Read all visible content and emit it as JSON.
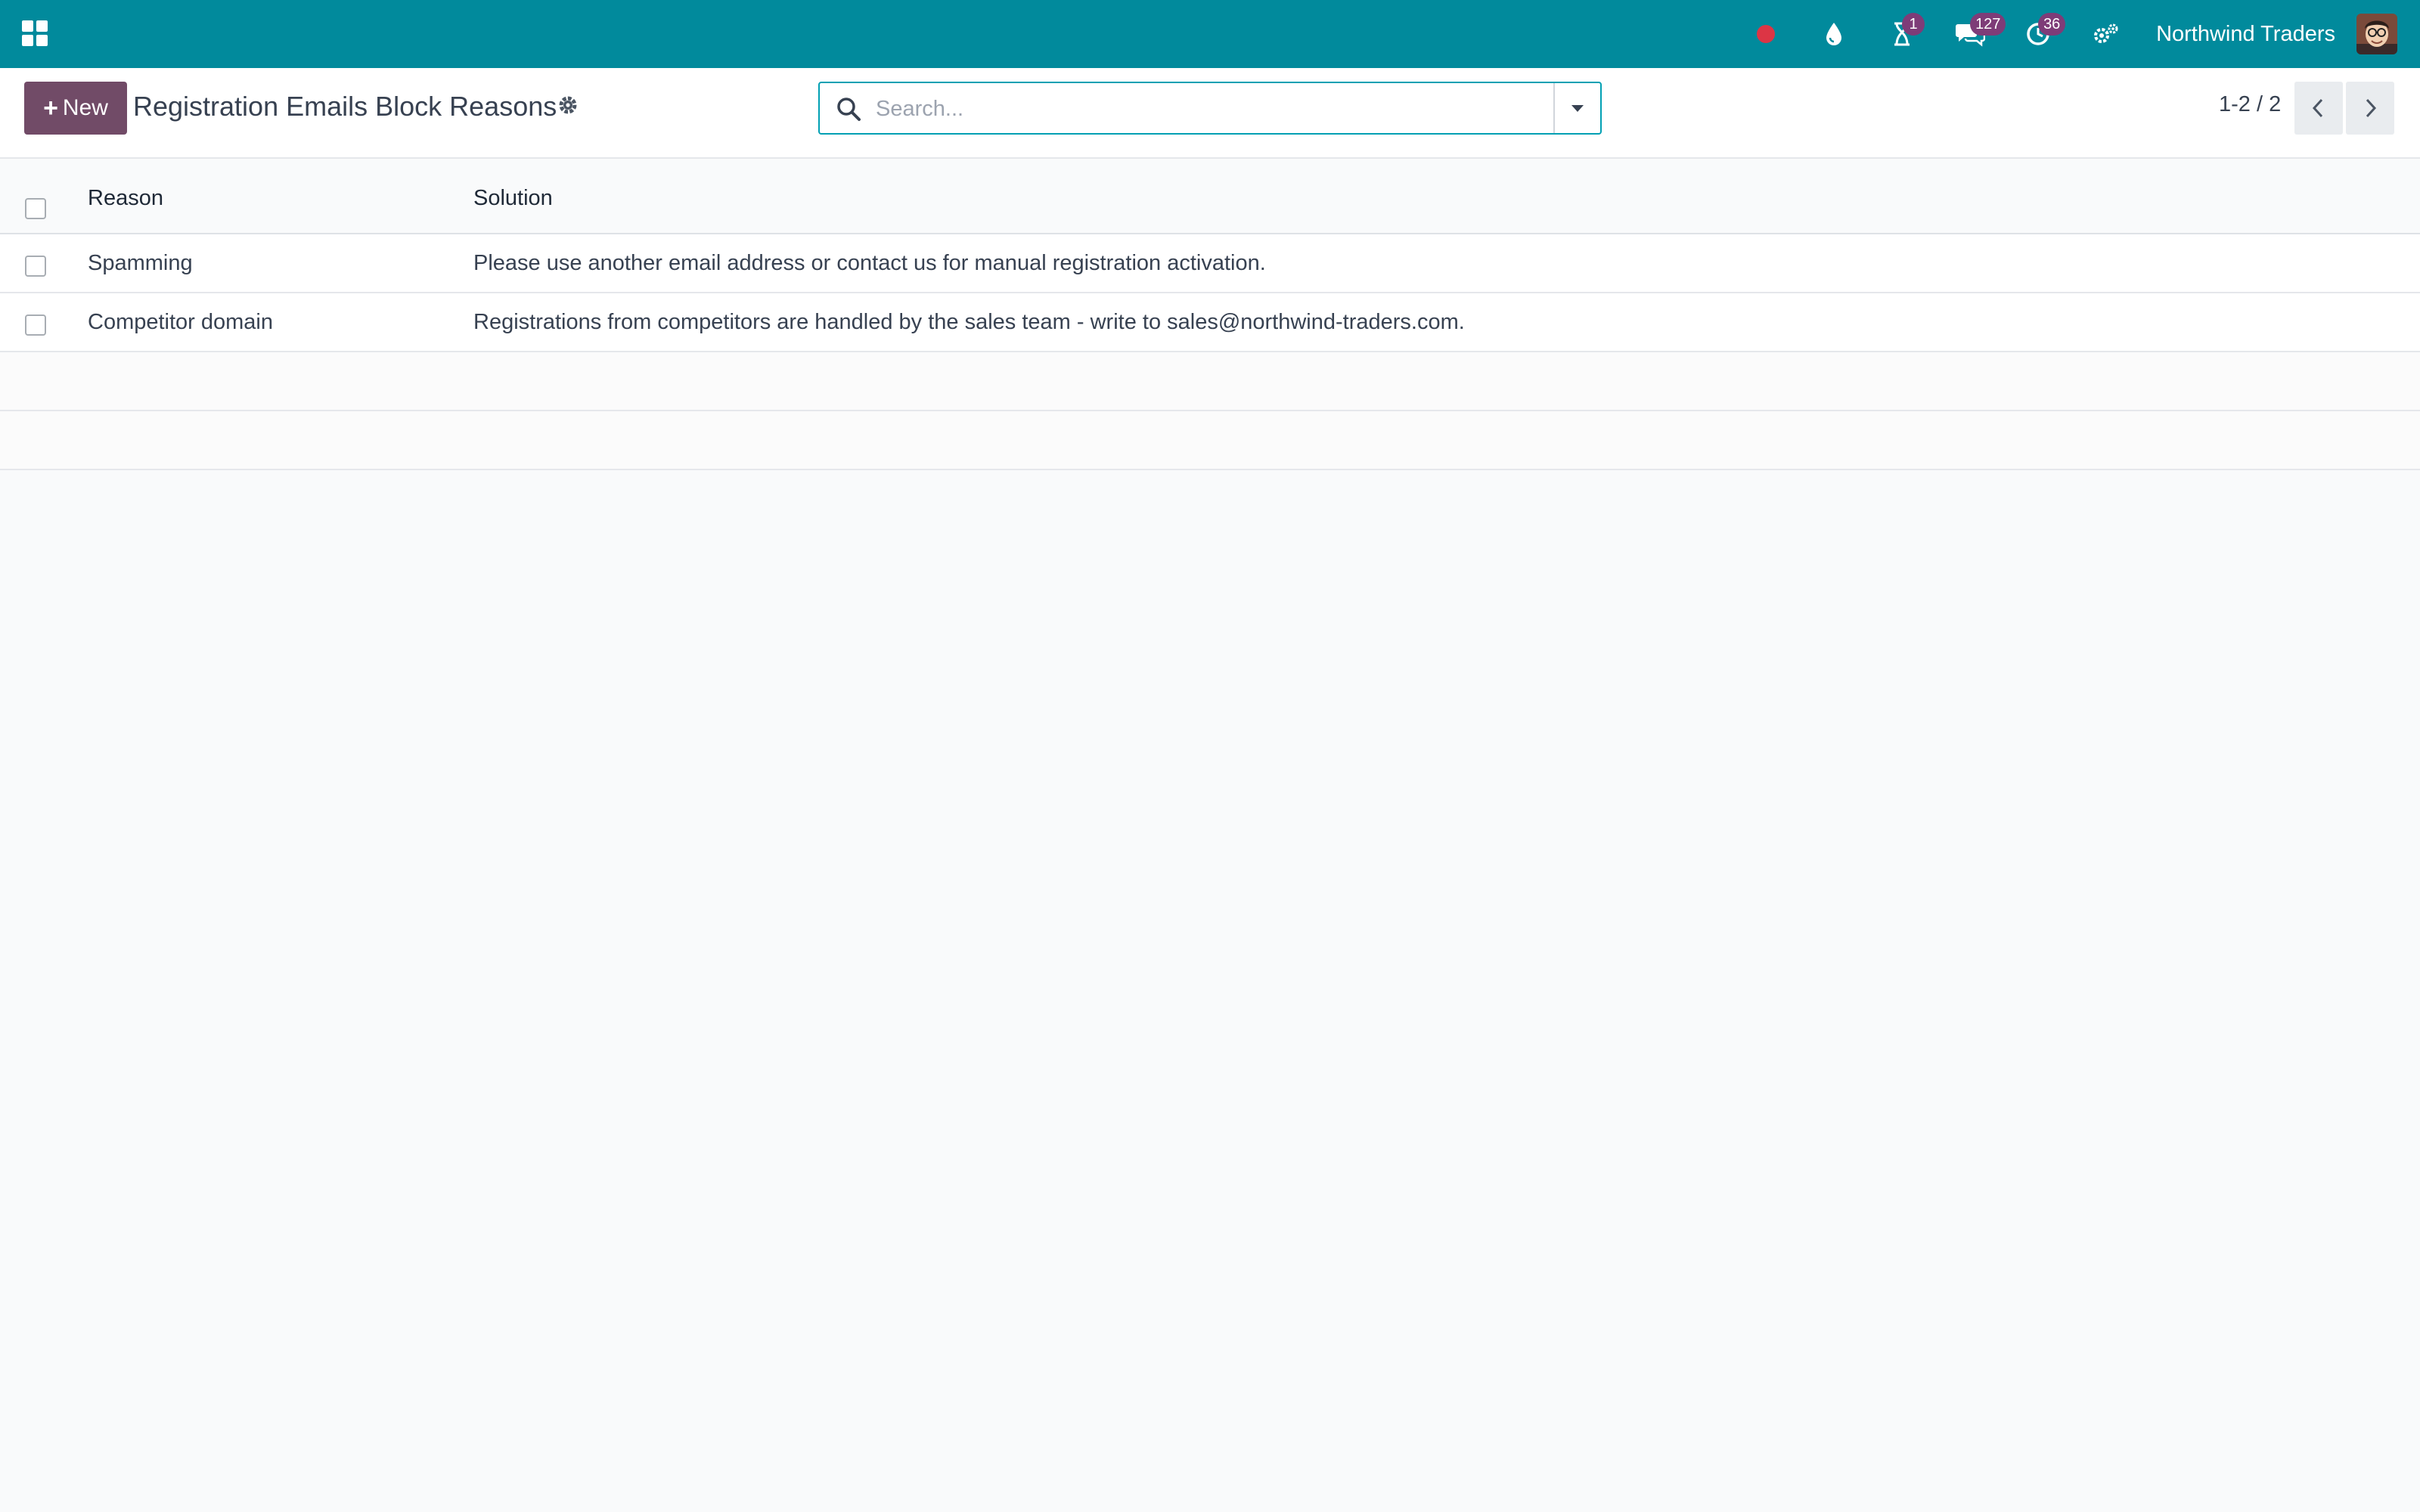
{
  "topbar": {
    "apps_icon": "grid-icon",
    "systray": [
      {
        "icon": "record-dot-icon",
        "color": "#dc3545",
        "badge": ""
      },
      {
        "icon": "drop-icon",
        "badge": ""
      },
      {
        "icon": "hourglass-icon",
        "badge": "1"
      },
      {
        "icon": "chat-bubbles-icon",
        "badge": "127"
      },
      {
        "icon": "activity-clock-icon",
        "badge": "36"
      },
      {
        "icon": "gears-icon",
        "badge": ""
      }
    ],
    "company": "Northwind Traders",
    "colors": {
      "bar": "#018a9c",
      "badge": "#7e3c78"
    }
  },
  "control_panel": {
    "new_label": "New",
    "title": "Registration Emails Block Reasons",
    "search": {
      "placeholder": "Search...",
      "value": ""
    },
    "pager": {
      "value": "1-2 / 2"
    },
    "colors": {
      "primary": "#714b67",
      "search_border": "#01a0b3"
    }
  },
  "list": {
    "columns": [
      "Reason",
      "Solution"
    ],
    "rows": [
      {
        "reason": "Spamming",
        "solution": "Please use another email address or contact us for manual registration activation."
      },
      {
        "reason": "Competitor domain",
        "solution": "Registrations from competitors are handled by the sales team - write to sales@northwind-traders.com."
      }
    ]
  }
}
